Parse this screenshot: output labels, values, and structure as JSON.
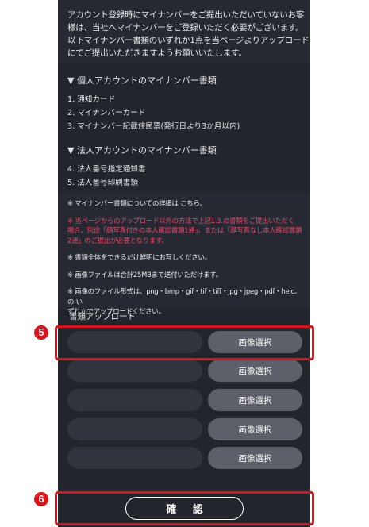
{
  "intro": {
    "lines": [
      "アカウント登録時にマイナンバーをご提出いただいていないお客",
      "様は、当社へマイナンバーをご登録いただく必要がございます。",
      "以下マイナンバー書類のいずれか1点を当ページよりアップロード",
      "にてご提出いただきますようお願いいたします。"
    ]
  },
  "individual": {
    "heading": "▼ 個人アカウントのマイナンバー書類",
    "items": [
      "1. 通知カード",
      "2. マイナンバーカード",
      "3. マイナンバー記載住民票(発行日より3か月以内)"
    ]
  },
  "corporate": {
    "heading": "▼ 法人アカウントのマイナンバー書類",
    "items": [
      "4. 法人番号指定通知書",
      "5. 法人番号印刷書類"
    ]
  },
  "notes": {
    "detail": "※ マイナンバー書類についての詳細は こちら。",
    "red_lines": [
      "※ 当ページからのアップロード以外の方法で上記1.3.の書類をご提出いただく",
      "場合、別途「顔写真付きの本人確認書類1通」、または「顔写真なし本人確認書類",
      "2通」のご提出が必要となります。"
    ],
    "clear": "※ 書類全体をできるだけ鮮明にお写しください。",
    "size": "※ 画像ファイルは合計25MBまで送付いただけます。",
    "format_lines": [
      "※ 画像のファイル形式は、png・bmp・gif・tif・tiff・jpg・jpeg・pdf・heic、　の い",
      "ずれかでアップロードください。"
    ]
  },
  "upload": {
    "label": "書類アップロード",
    "select_label": "画像選択"
  },
  "confirm_label": "確 認",
  "badges": {
    "upload": "5",
    "confirm": "6"
  },
  "colors": {
    "background": "#22252c",
    "panel": "#262931",
    "button": "#5d6069",
    "warning": "#e8476a",
    "highlight": "#e10f19"
  }
}
